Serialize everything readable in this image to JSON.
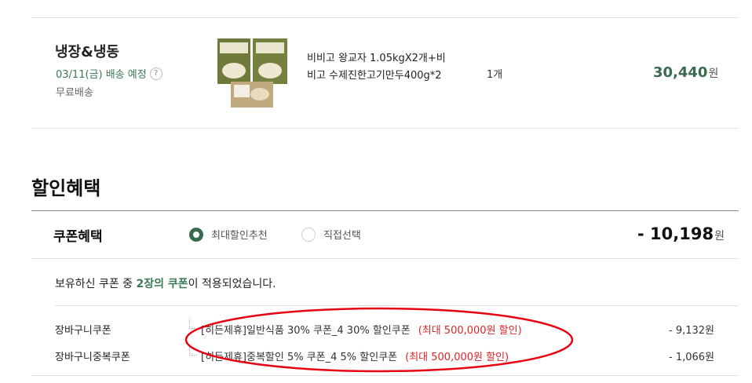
{
  "order_item": {
    "category": "냉장&냉동",
    "delivery_date": "03/11(금) 배송 예정",
    "help_symbol": "?",
    "shipping": "무료배송",
    "product_name": "비비고 왕교자 1.05kgX2개+비비고 수제진한고기만두400g*2",
    "quantity": "1개",
    "price": "30,440",
    "currency": "원"
  },
  "discount_section": {
    "title": "할인혜택",
    "coupon_benefit_label": "쿠폰혜택",
    "options": [
      {
        "label": "최대할인추천",
        "selected": true
      },
      {
        "label": "직접선택",
        "selected": false
      }
    ],
    "total_discount": "- 10,198",
    "currency": "원",
    "notice": {
      "prefix": "보유하신 쿠폰 중 ",
      "highlight": "2장의 쿠폰",
      "suffix": "이 적용되었습니다."
    },
    "coupons": [
      {
        "type": "장바구니쿠폰",
        "description": "[히든제휴]일반식품 30% 쿠폰_4 30% 할인쿠폰",
        "max": "(최대 500,000원 할인)",
        "amount": "- 9,132원"
      },
      {
        "type": "장바구니중복쿠폰",
        "description": "[히든제휴]중복할인 5% 쿠폰_4 5% 할인쿠폰",
        "max": "(최대 500,000원 할인)",
        "amount": "- 1,066원"
      }
    ]
  },
  "colors": {
    "accent_green": "#3a6b4e",
    "highlight_red": "#e02424"
  }
}
